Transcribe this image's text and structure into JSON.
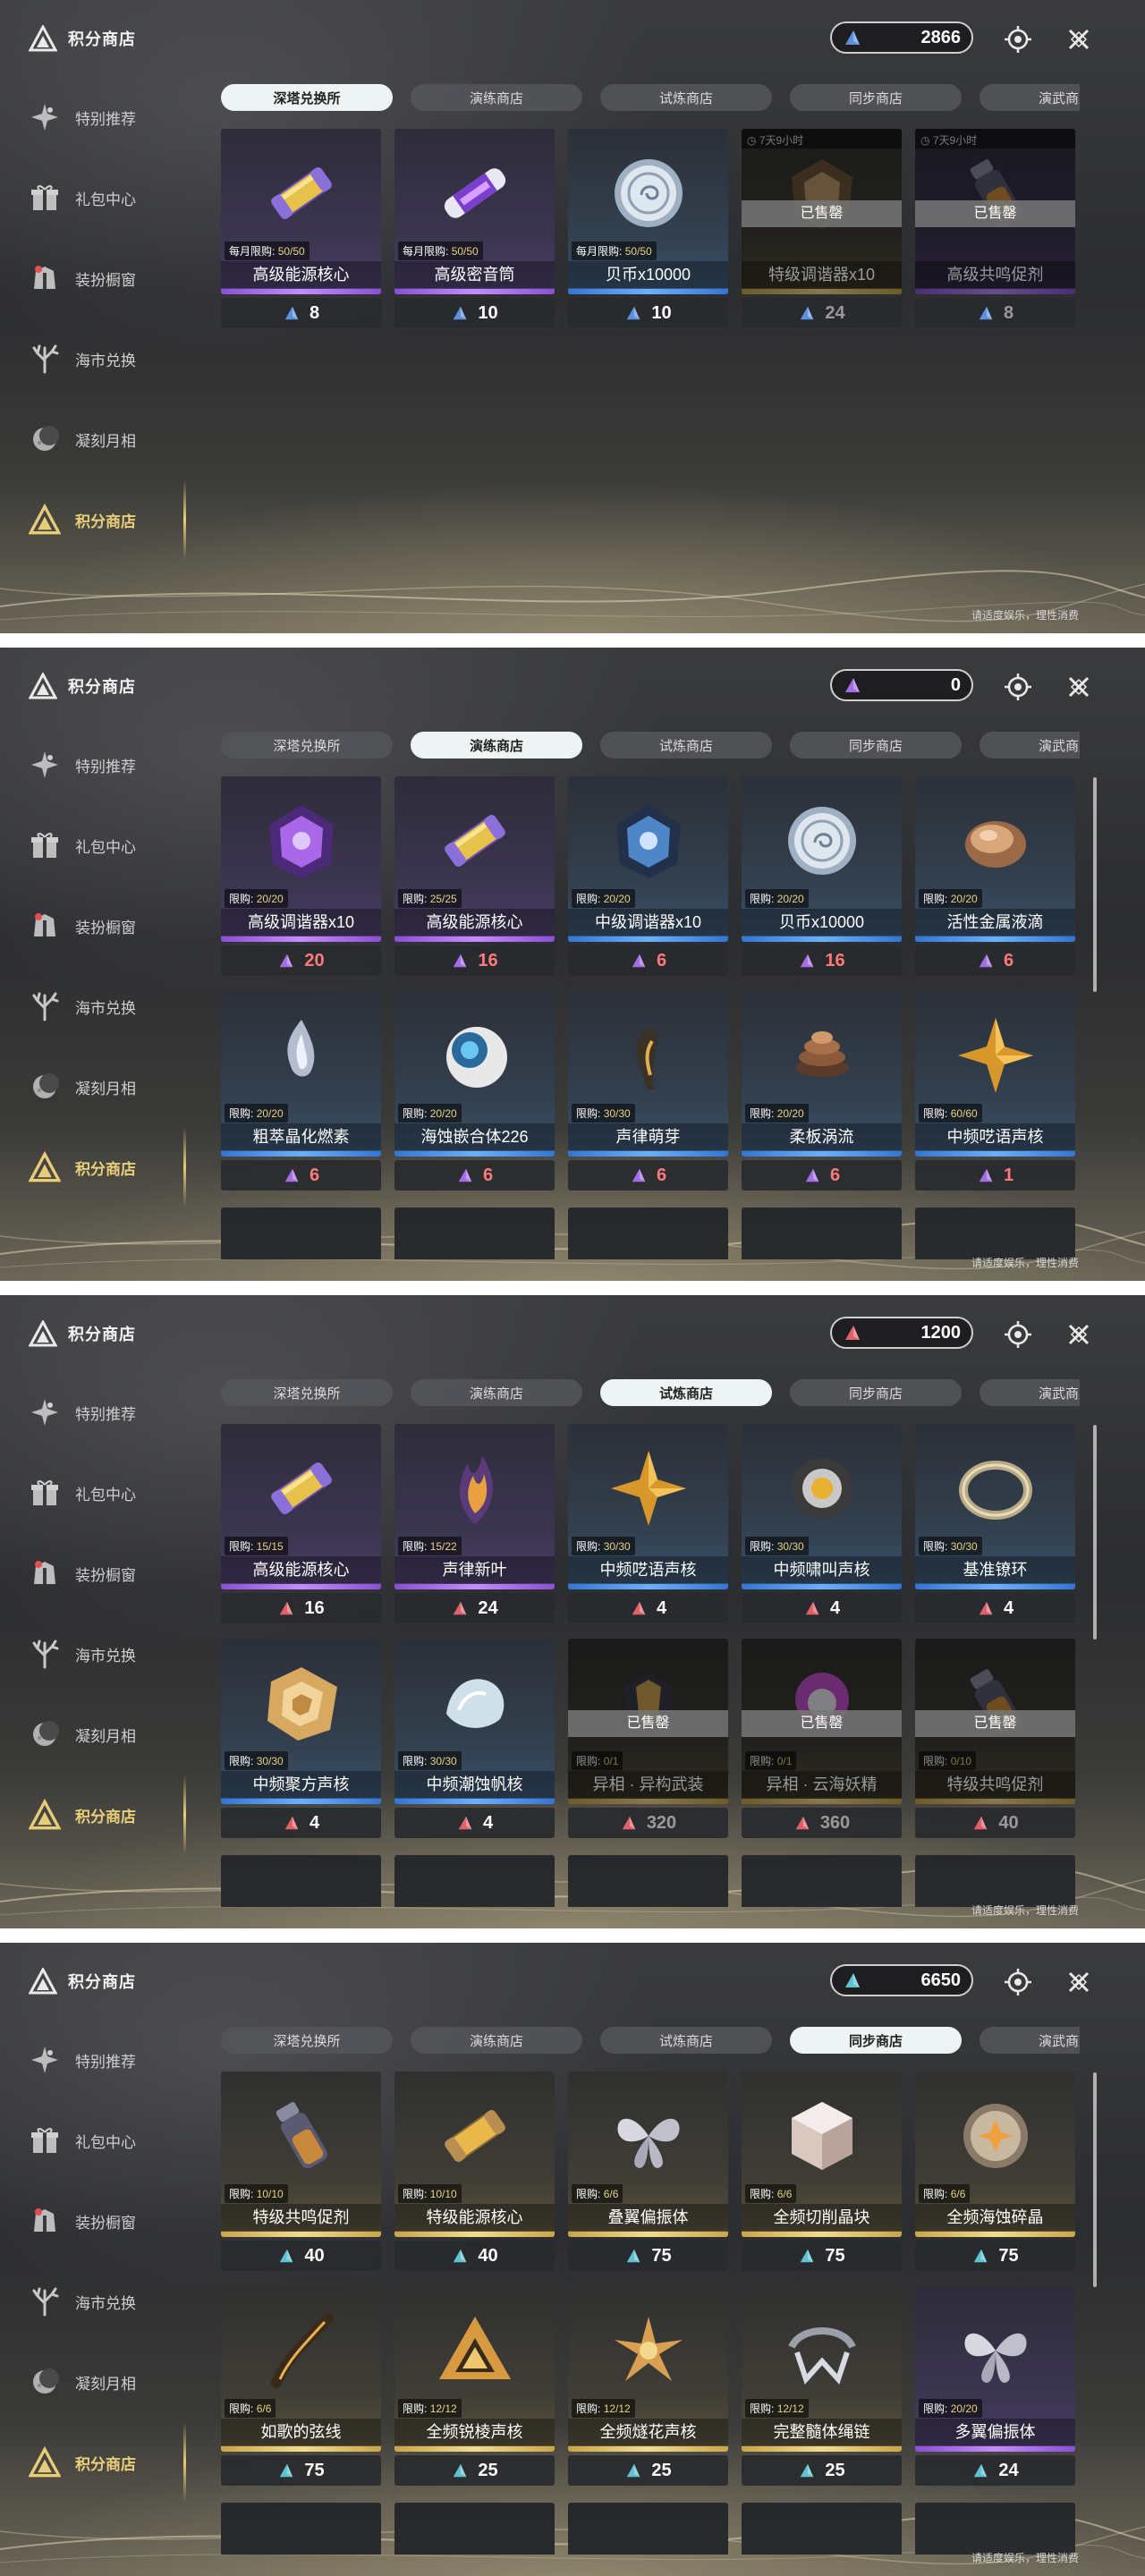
{
  "app": {
    "title": "积分商店"
  },
  "nav": [
    "特别推荐",
    "礼包中心",
    "装扮橱窗",
    "海市兑换",
    "凝刻月相",
    "积分商店"
  ],
  "tabs": [
    "深塔兑换所",
    "演练商店",
    "试炼商店",
    "同步商店",
    "演武商店"
  ],
  "footer": "请适度娱乐，理性消费",
  "panels": [
    {
      "active_tab": 0,
      "currency": {
        "amount": "2866",
        "color": "#5b8fe0"
      },
      "rows": 1,
      "items": [
        {
          "name": "高级能源核心",
          "limit_label": "每月限购:",
          "limit": "50/50",
          "price": "8",
          "rarity": "purple",
          "art": "capsule-purple"
        },
        {
          "name": "高级密音筒",
          "limit_label": "每月限购:",
          "limit": "50/50",
          "price": "10",
          "rarity": "purple",
          "art": "cylinder-purple"
        },
        {
          "name": "贝币x10000",
          "limit_label": "每月限购:",
          "limit": "50/50",
          "price": "10",
          "rarity": "blue",
          "art": "coin"
        },
        {
          "name": "特级调谐器x10",
          "timer": "7天9小时",
          "sold_label": "已售罄",
          "price": "24",
          "rarity": "gold",
          "art": "tuner-gold",
          "sold": true
        },
        {
          "name": "高级共鸣促剂",
          "timer": "7天9小时",
          "sold_label": "已售罄",
          "price": "8",
          "rarity": "purple",
          "art": "vial",
          "sold": true
        }
      ]
    },
    {
      "active_tab": 1,
      "currency": {
        "amount": "0",
        "color": "#a56ee6"
      },
      "rows": 2,
      "items": [
        {
          "name": "高级调谐器x10",
          "limit_label": "限购:",
          "limit": "20/20",
          "price": "20",
          "rarity": "purple",
          "art": "tuner-purple",
          "price_red": true
        },
        {
          "name": "高级能源核心",
          "limit_label": "限购:",
          "limit": "25/25",
          "price": "16",
          "rarity": "purple",
          "art": "capsule-purple",
          "price_red": true
        },
        {
          "name": "中级调谐器x10",
          "limit_label": "限购:",
          "limit": "20/20",
          "price": "6",
          "rarity": "blue",
          "art": "tuner-blue",
          "price_red": true
        },
        {
          "name": "贝币x10000",
          "limit_label": "限购:",
          "limit": "20/20",
          "price": "16",
          "rarity": "blue",
          "art": "coin",
          "price_red": true
        },
        {
          "name": "活性金属液滴",
          "limit_label": "限购:",
          "limit": "20/20",
          "price": "6",
          "rarity": "blue",
          "art": "metal-drop",
          "price_red": true
        },
        {
          "name": "粗萃晶化燃素",
          "limit_label": "限购:",
          "limit": "20/20",
          "price": "6",
          "rarity": "blue",
          "art": "crystal-flame",
          "price_red": true
        },
        {
          "name": "海蚀嵌合体226",
          "limit_label": "限购:",
          "limit": "20/20",
          "price": "6",
          "rarity": "blue",
          "art": "orb",
          "price_red": true
        },
        {
          "name": "声律萌芽",
          "limit_label": "限购:",
          "limit": "30/30",
          "price": "6",
          "rarity": "blue",
          "art": "sprout",
          "price_red": true
        },
        {
          "name": "柔板涡流",
          "limit_label": "限购:",
          "limit": "20/20",
          "price": "6",
          "rarity": "blue",
          "art": "vortex",
          "price_red": true
        },
        {
          "name": "中频呓语声核",
          "limit_label": "限购:",
          "limit": "60/60",
          "price": "1",
          "rarity": "blue",
          "art": "star",
          "price_red": true
        }
      ]
    },
    {
      "active_tab": 2,
      "currency": {
        "amount": "1200",
        "color": "#e0606a"
      },
      "rows": 2,
      "items": [
        {
          "name": "高级能源核心",
          "limit_label": "限购:",
          "limit": "15/15",
          "price": "16",
          "rarity": "purple",
          "art": "capsule-purple"
        },
        {
          "name": "声律新叶",
          "limit_label": "限购:",
          "limit": "15/22",
          "price": "24",
          "rarity": "purple",
          "art": "leaf-flame"
        },
        {
          "name": "中频呓语声核",
          "limit_label": "限购:",
          "limit": "30/30",
          "price": "4",
          "rarity": "blue",
          "art": "star"
        },
        {
          "name": "中频啸叫声核",
          "limit_label": "限购:",
          "limit": "30/30",
          "price": "4",
          "rarity": "blue",
          "art": "core-gold"
        },
        {
          "name": "基准镣环",
          "limit_label": "限购:",
          "limit": "30/30",
          "price": "4",
          "rarity": "blue",
          "art": "ring"
        },
        {
          "name": "中频聚方声核",
          "limit_label": "限购:",
          "limit": "30/30",
          "price": "4",
          "rarity": "blue",
          "art": "cube-gold"
        },
        {
          "name": "中频潮蚀帆核",
          "limit_label": "限购:",
          "limit": "30/30",
          "price": "4",
          "rarity": "blue",
          "art": "shell"
        },
        {
          "name": "异相 · 异构武装",
          "limit_label": "限购:",
          "limit": "0/1",
          "sold_label": "已售罄",
          "price": "320",
          "rarity": "gold",
          "art": "armor",
          "sold": true
        },
        {
          "name": "异相 · 云海妖精",
          "limit_label": "限购:",
          "limit": "0/1",
          "sold_label": "已售罄",
          "price": "360",
          "rarity": "gold",
          "art": "fairy",
          "sold": true
        },
        {
          "name": "特级共鸣促剂",
          "limit_label": "限购:",
          "limit": "0/10",
          "sold_label": "已售罄",
          "price": "40",
          "rarity": "gold",
          "art": "vial",
          "sold": true
        }
      ]
    },
    {
      "active_tab": 3,
      "currency": {
        "amount": "6650",
        "color": "#5ec2d0"
      },
      "rows": 2,
      "items": [
        {
          "name": "特级共鸣促剂",
          "limit_label": "限购:",
          "limit": "10/10",
          "price": "40",
          "rarity": "gold",
          "art": "vial"
        },
        {
          "name": "特级能源核心",
          "limit_label": "限购:",
          "limit": "10/10",
          "price": "40",
          "rarity": "gold",
          "art": "capsule-gold"
        },
        {
          "name": "叠翼偏振体",
          "limit_label": "限购:",
          "limit": "6/6",
          "price": "75",
          "rarity": "gold",
          "art": "wings-silver"
        },
        {
          "name": "全频切削晶块",
          "limit_label": "限购:",
          "limit": "6/6",
          "price": "75",
          "rarity": "gold",
          "art": "cube-crystal"
        },
        {
          "name": "全频海蚀碎晶",
          "limit_label": "限购:",
          "limit": "6/6",
          "price": "75",
          "rarity": "gold",
          "art": "disc-crystal"
        },
        {
          "name": "如歌的弦线",
          "limit_label": "限购:",
          "limit": "6/6",
          "price": "75",
          "rarity": "gold",
          "art": "strings"
        },
        {
          "name": "全频锐棱声核",
          "limit_label": "限购:",
          "limit": "12/12",
          "price": "25",
          "rarity": "gold",
          "art": "triangle-gold"
        },
        {
          "name": "全频燧花声核",
          "limit_label": "限购:",
          "limit": "12/12",
          "price": "25",
          "rarity": "gold",
          "art": "flower-gold"
        },
        {
          "name": "完整髓体绳链",
          "limit_label": "限购:",
          "limit": "12/12",
          "price": "25",
          "rarity": "gold",
          "art": "chain"
        },
        {
          "name": "多翼偏振体",
          "limit_label": "限购:",
          "limit": "20/20",
          "price": "24",
          "rarity": "purple",
          "art": "wings-silver"
        }
      ]
    }
  ]
}
